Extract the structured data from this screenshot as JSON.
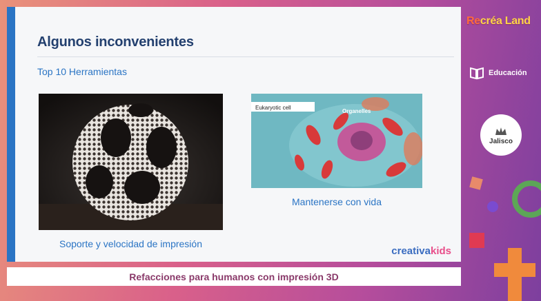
{
  "slide": {
    "title": "Algunos inconvenientes",
    "subtitle": "Top 10 Herramientas",
    "left_caption": "Soporte y velocidad de impresión",
    "right_caption": "Mantenerse con vida",
    "cell_labels": {
      "eukaryotic": "Eukaryotic cell",
      "organelles": "Organelles"
    },
    "watermark": {
      "part1": "creativa",
      "part2": "kids"
    }
  },
  "caption_bar": {
    "text": "Refacciones para humanos con impresión 3D"
  },
  "sidebar": {
    "brand": {
      "part1": "Re",
      "part2": "créa Land"
    },
    "education_label": "Educación",
    "jalisco_label": "Jalisco"
  },
  "colors": {
    "accent_blue": "#2a74c4",
    "title_navy": "#23406f",
    "caption_magenta": "#8a3a6a",
    "brand_yellow": "#ffd447"
  }
}
